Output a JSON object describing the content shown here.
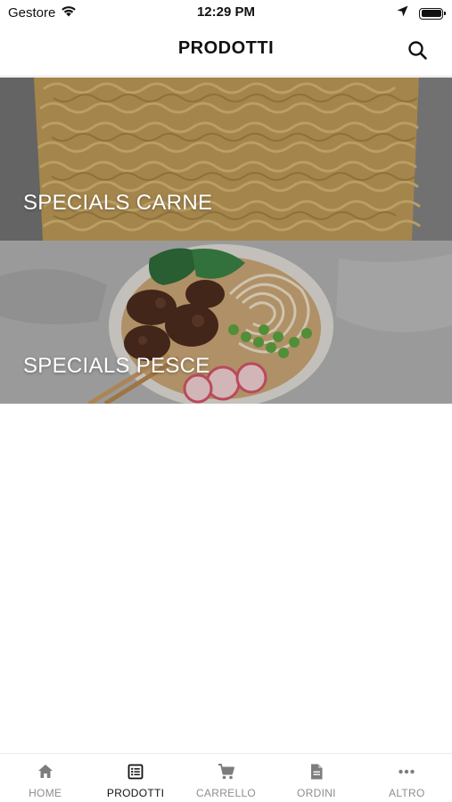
{
  "status_bar": {
    "carrier": "Gestore",
    "time": "12:29 PM",
    "icons": [
      "wifi-icon",
      "location-arrow-icon",
      "battery-icon"
    ]
  },
  "header": {
    "title": "PRODOTTI",
    "search_icon": "search-icon"
  },
  "categories": [
    {
      "label": "SPECIALS CARNE"
    },
    {
      "label": "SPECIALS PESCE"
    }
  ],
  "tab_bar": {
    "items": [
      {
        "label": "HOME",
        "icon": "home-icon",
        "active": false
      },
      {
        "label": "PRODOTTI",
        "icon": "list-icon",
        "active": true
      },
      {
        "label": "CARRELLO",
        "icon": "cart-icon",
        "active": false
      },
      {
        "label": "ORDINI",
        "icon": "document-icon",
        "active": false
      },
      {
        "label": "ALTRO",
        "icon": "more-icon",
        "active": false
      }
    ]
  },
  "colors": {
    "active_tab": "#111111",
    "inactive_tab": "#8e8e8e",
    "overlay_text": "#ffffff"
  }
}
